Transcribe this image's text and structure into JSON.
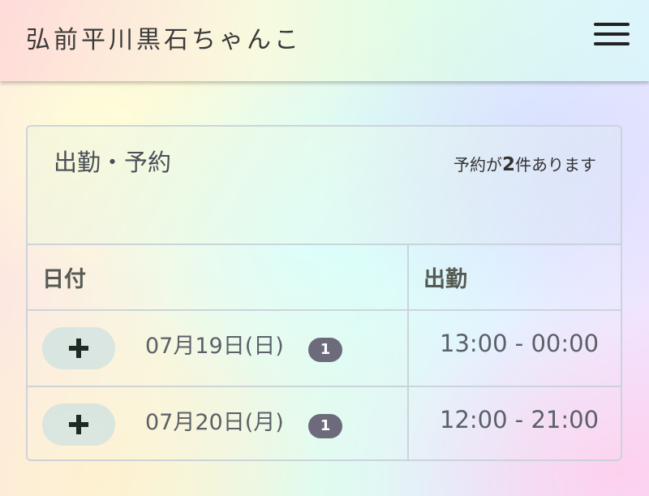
{
  "header": {
    "title": "弘前平川黒石ちゃんこ",
    "menu_icon": "hamburger-menu-icon"
  },
  "card": {
    "title": "出勤・予約",
    "reservation_note": {
      "prefix": "予約が",
      "count": "2",
      "suffix": "件あります"
    }
  },
  "table": {
    "columns": [
      "日付",
      "出勤"
    ],
    "rows": [
      {
        "add_label": "+",
        "date": "07月19日(日)",
        "badge": "1",
        "shift": "13:00 - 00:00"
      },
      {
        "add_label": "+",
        "date": "07月20日(月)",
        "badge": "1",
        "shift": "12:00 - 21:00"
      }
    ]
  }
}
